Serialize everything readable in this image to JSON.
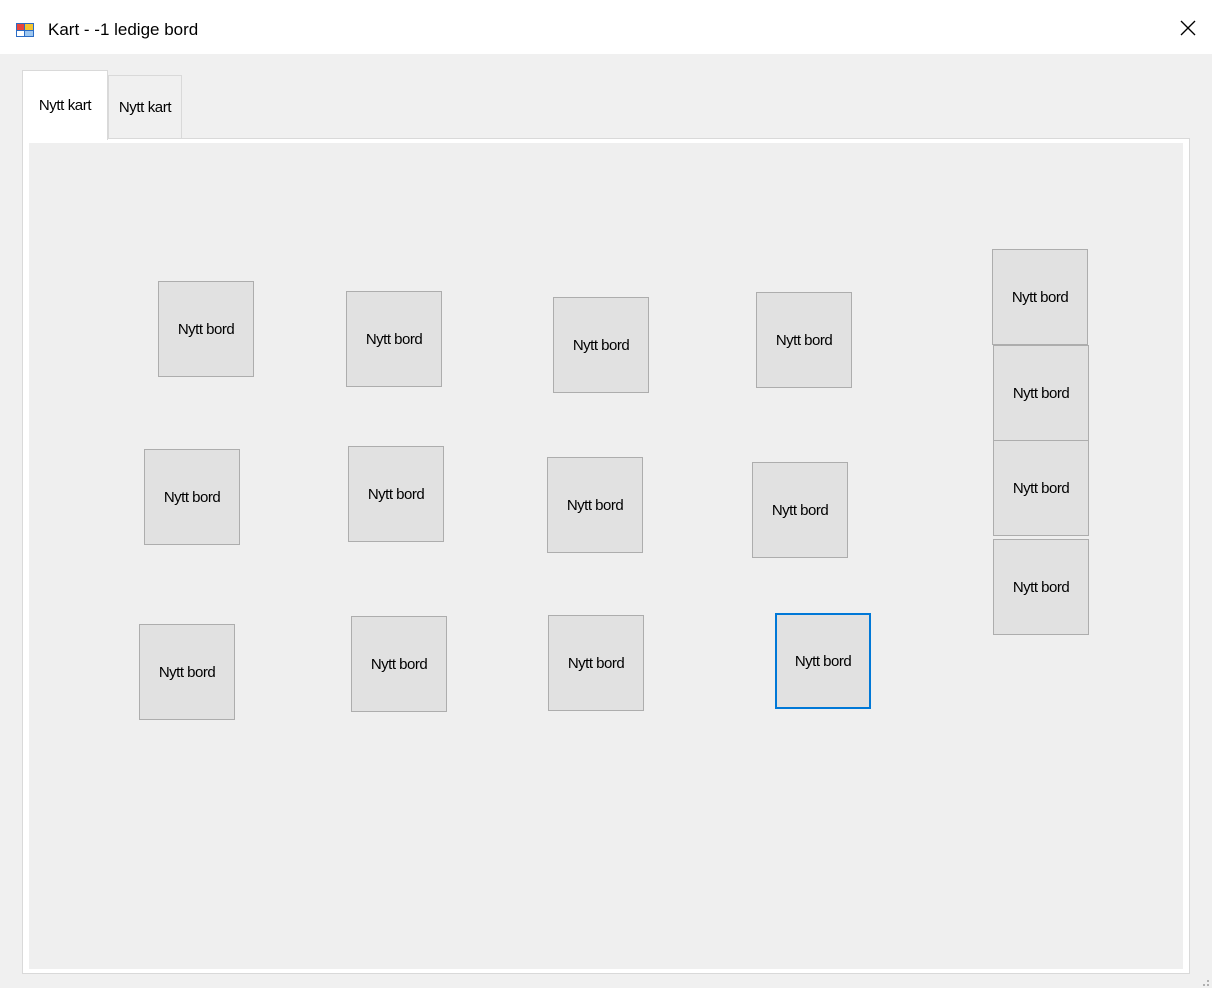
{
  "window": {
    "title": "Kart - -1 ledige bord",
    "icon": "form-app-icon",
    "close_icon": "close-icon"
  },
  "tabs": [
    {
      "label": "Nytt kart",
      "active": true
    },
    {
      "label": "Nytt kart",
      "active": false
    }
  ],
  "tables": [
    {
      "label": "Nytt bord"
    },
    {
      "label": "Nytt bord"
    },
    {
      "label": "Nytt bord"
    },
    {
      "label": "Nytt bord"
    },
    {
      "label": "Nytt bord"
    },
    {
      "label": "Nytt bord"
    },
    {
      "label": "Nytt bord"
    },
    {
      "label": "Nytt bord"
    },
    {
      "label": "Nytt bord"
    },
    {
      "label": "Nytt bord"
    },
    {
      "label": "Nytt bord"
    },
    {
      "label": "Nytt bord"
    },
    {
      "label": "Nytt bord"
    },
    {
      "label": "Nytt bord"
    },
    {
      "label": "Nytt bord"
    },
    {
      "label": "Nytt bord"
    }
  ],
  "colors": {
    "focus_border": "#0078d7",
    "button_face": "#e1e1e1",
    "button_border": "#adadad"
  }
}
